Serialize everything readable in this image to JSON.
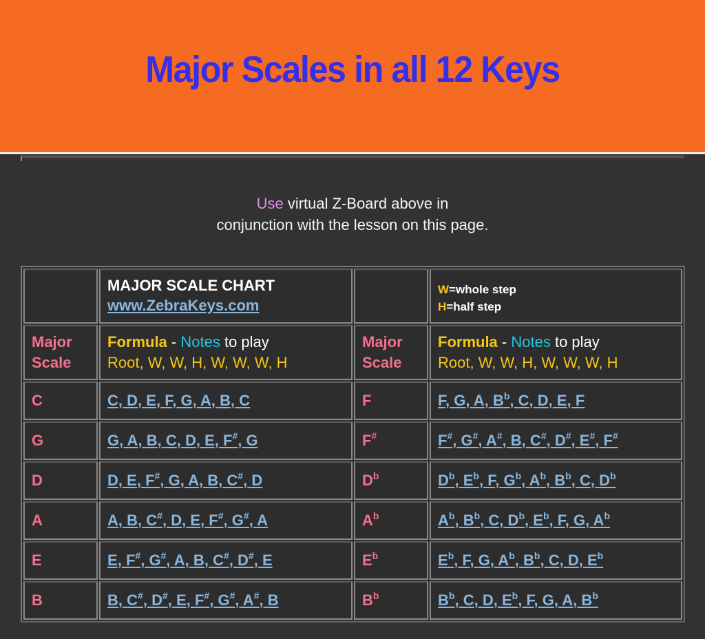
{
  "banner": {
    "title": "Major Scales in all 12 Keys"
  },
  "intro": {
    "highlight": "Use",
    "line1_rest": " virtual Z-Board above in",
    "line2": "conjunction with the lesson on this page."
  },
  "chart": {
    "title": "MAJOR SCALE CHART",
    "site_link": "www.ZebraKeys.com",
    "legend": {
      "w_key": "W",
      "w_text": "=whole step",
      "h_key": "H",
      "h_text": "=half step"
    },
    "col_header": {
      "scale_line1": "Major",
      "scale_line2": "Scale",
      "formula_word": "Formula",
      "dash": " - ",
      "notes_word": "Notes",
      "to_play": " to play",
      "formula": "Root, W, W, H, W, W, W, H"
    },
    "rows": [
      {
        "left": {
          "key": "C",
          "acc": "",
          "notes": [
            [
              "C",
              ""
            ],
            [
              "D",
              ""
            ],
            [
              "E",
              ""
            ],
            [
              "F",
              ""
            ],
            [
              "G",
              ""
            ],
            [
              "A",
              ""
            ],
            [
              "B",
              ""
            ],
            [
              "C",
              ""
            ]
          ]
        },
        "right": {
          "key": "F",
          "acc": "",
          "notes": [
            [
              "F",
              ""
            ],
            [
              "G",
              ""
            ],
            [
              "A",
              ""
            ],
            [
              "B",
              "b"
            ],
            [
              "C",
              ""
            ],
            [
              "D",
              ""
            ],
            [
              "E",
              ""
            ],
            [
              "F",
              ""
            ]
          ]
        }
      },
      {
        "left": {
          "key": "G",
          "acc": "",
          "notes": [
            [
              "G",
              ""
            ],
            [
              "A",
              ""
            ],
            [
              "B",
              ""
            ],
            [
              "C",
              ""
            ],
            [
              "D",
              ""
            ],
            [
              "E",
              ""
            ],
            [
              "F",
              "#"
            ],
            [
              "G",
              ""
            ]
          ]
        },
        "right": {
          "key": "F",
          "acc": "#",
          "notes": [
            [
              "F",
              "#"
            ],
            [
              "G",
              "#"
            ],
            [
              "A",
              "#"
            ],
            [
              "B",
              ""
            ],
            [
              "C",
              "#"
            ],
            [
              "D",
              "#"
            ],
            [
              "E",
              "#"
            ],
            [
              "F",
              "#"
            ]
          ]
        }
      },
      {
        "left": {
          "key": "D",
          "acc": "",
          "notes": [
            [
              "D",
              ""
            ],
            [
              "E",
              ""
            ],
            [
              "F",
              "#"
            ],
            [
              "G",
              ""
            ],
            [
              "A",
              ""
            ],
            [
              "B",
              ""
            ],
            [
              "C",
              "#"
            ],
            [
              "D",
              ""
            ]
          ]
        },
        "right": {
          "key": "D",
          "acc": "b",
          "notes": [
            [
              "D",
              "b"
            ],
            [
              "E",
              "b"
            ],
            [
              "F",
              ""
            ],
            [
              "G",
              "b"
            ],
            [
              "A",
              "b"
            ],
            [
              "B",
              "b"
            ],
            [
              "C",
              ""
            ],
            [
              "D",
              "b"
            ]
          ]
        }
      },
      {
        "left": {
          "key": "A",
          "acc": "",
          "notes": [
            [
              "A",
              ""
            ],
            [
              "B",
              ""
            ],
            [
              "C",
              "#"
            ],
            [
              "D",
              ""
            ],
            [
              "E",
              ""
            ],
            [
              "F",
              "#"
            ],
            [
              "G",
              "#"
            ],
            [
              "A",
              ""
            ]
          ]
        },
        "right": {
          "key": "A",
          "acc": "b",
          "notes": [
            [
              "A",
              "b"
            ],
            [
              "B",
              "b"
            ],
            [
              "C",
              ""
            ],
            [
              "D",
              "b"
            ],
            [
              "E",
              "b"
            ],
            [
              "F",
              ""
            ],
            [
              "G",
              ""
            ],
            [
              "A",
              "b"
            ]
          ]
        }
      },
      {
        "left": {
          "key": "E",
          "acc": "",
          "notes": [
            [
              "E",
              ""
            ],
            [
              "F",
              "#"
            ],
            [
              "G",
              "#"
            ],
            [
              "A",
              ""
            ],
            [
              "B",
              ""
            ],
            [
              "C",
              "#"
            ],
            [
              "D",
              "#"
            ],
            [
              "E",
              ""
            ]
          ]
        },
        "right": {
          "key": "E",
          "acc": "b",
          "notes": [
            [
              "E",
              "b"
            ],
            [
              "F",
              ""
            ],
            [
              "G",
              ""
            ],
            [
              "A",
              "b"
            ],
            [
              "B",
              "b"
            ],
            [
              "C",
              ""
            ],
            [
              "D",
              ""
            ],
            [
              "E",
              "b"
            ]
          ]
        }
      },
      {
        "left": {
          "key": "B",
          "acc": "",
          "notes": [
            [
              "B",
              ""
            ],
            [
              "C",
              "#"
            ],
            [
              "D",
              "#"
            ],
            [
              "E",
              ""
            ],
            [
              "F",
              "#"
            ],
            [
              "G",
              "#"
            ],
            [
              "A",
              "#"
            ],
            [
              "B",
              ""
            ]
          ]
        },
        "right": {
          "key": "B",
          "acc": "b",
          "notes": [
            [
              "B",
              "b"
            ],
            [
              "C",
              ""
            ],
            [
              "D",
              ""
            ],
            [
              "E",
              "b"
            ],
            [
              "F",
              ""
            ],
            [
              "G",
              ""
            ],
            [
              "A",
              ""
            ],
            [
              "B",
              "b"
            ]
          ]
        }
      }
    ]
  },
  "colors": {
    "banner_bg": "#F56B22",
    "title": "#3530E6",
    "page_bg": "#323232",
    "key_label": "#F2708E",
    "link": "#8AB6DC",
    "formula": "#F5C518",
    "notes_word": "#22C8E6",
    "use_word": "#E08EE8"
  }
}
